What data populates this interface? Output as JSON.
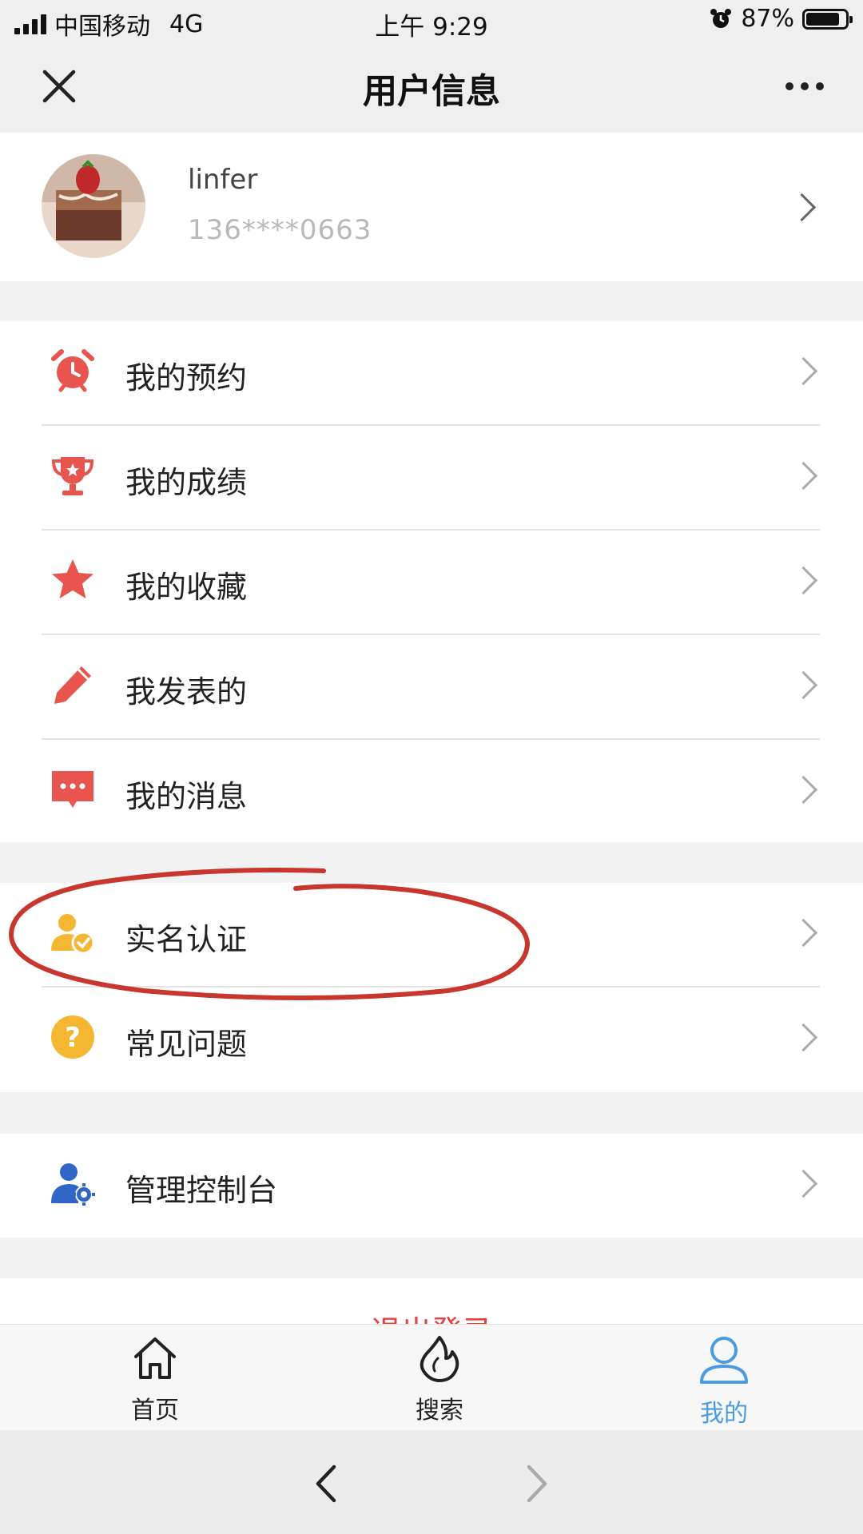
{
  "status_bar": {
    "carrier": "中国移动",
    "network": "4G",
    "time": "上午 9:29",
    "battery_percent": "87%",
    "battery_level": 0.87
  },
  "header": {
    "title": "用户信息",
    "close_icon": "close-icon",
    "more_icon": "more-icon"
  },
  "profile": {
    "username": "linfer",
    "phone": "136****0663"
  },
  "menu_group_1": [
    {
      "label": "我的预约",
      "icon": "alarm-clock-icon",
      "color": "#e8544e"
    },
    {
      "label": "我的成绩",
      "icon": "trophy-icon",
      "color": "#e8544e"
    },
    {
      "label": "我的收藏",
      "icon": "star-icon",
      "color": "#e8544e"
    },
    {
      "label": "我发表的",
      "icon": "pencil-icon",
      "color": "#e8544e"
    },
    {
      "label": "我的消息",
      "icon": "message-icon",
      "color": "#e8544e"
    }
  ],
  "menu_group_2": [
    {
      "label": "实名认证",
      "icon": "verified-user-icon",
      "color": "#f5b731"
    },
    {
      "label": "常见问题",
      "icon": "question-icon",
      "color": "#f5b731"
    }
  ],
  "menu_group_3": [
    {
      "label": "管理控制台",
      "icon": "user-settings-icon",
      "color": "#2f66c8"
    }
  ],
  "logout": {
    "label": "退出登录"
  },
  "tabbar": {
    "home": "首页",
    "search": "搜索",
    "mine": "我的",
    "active_color": "#4a9be0"
  },
  "annotation_color": "#c8372d"
}
